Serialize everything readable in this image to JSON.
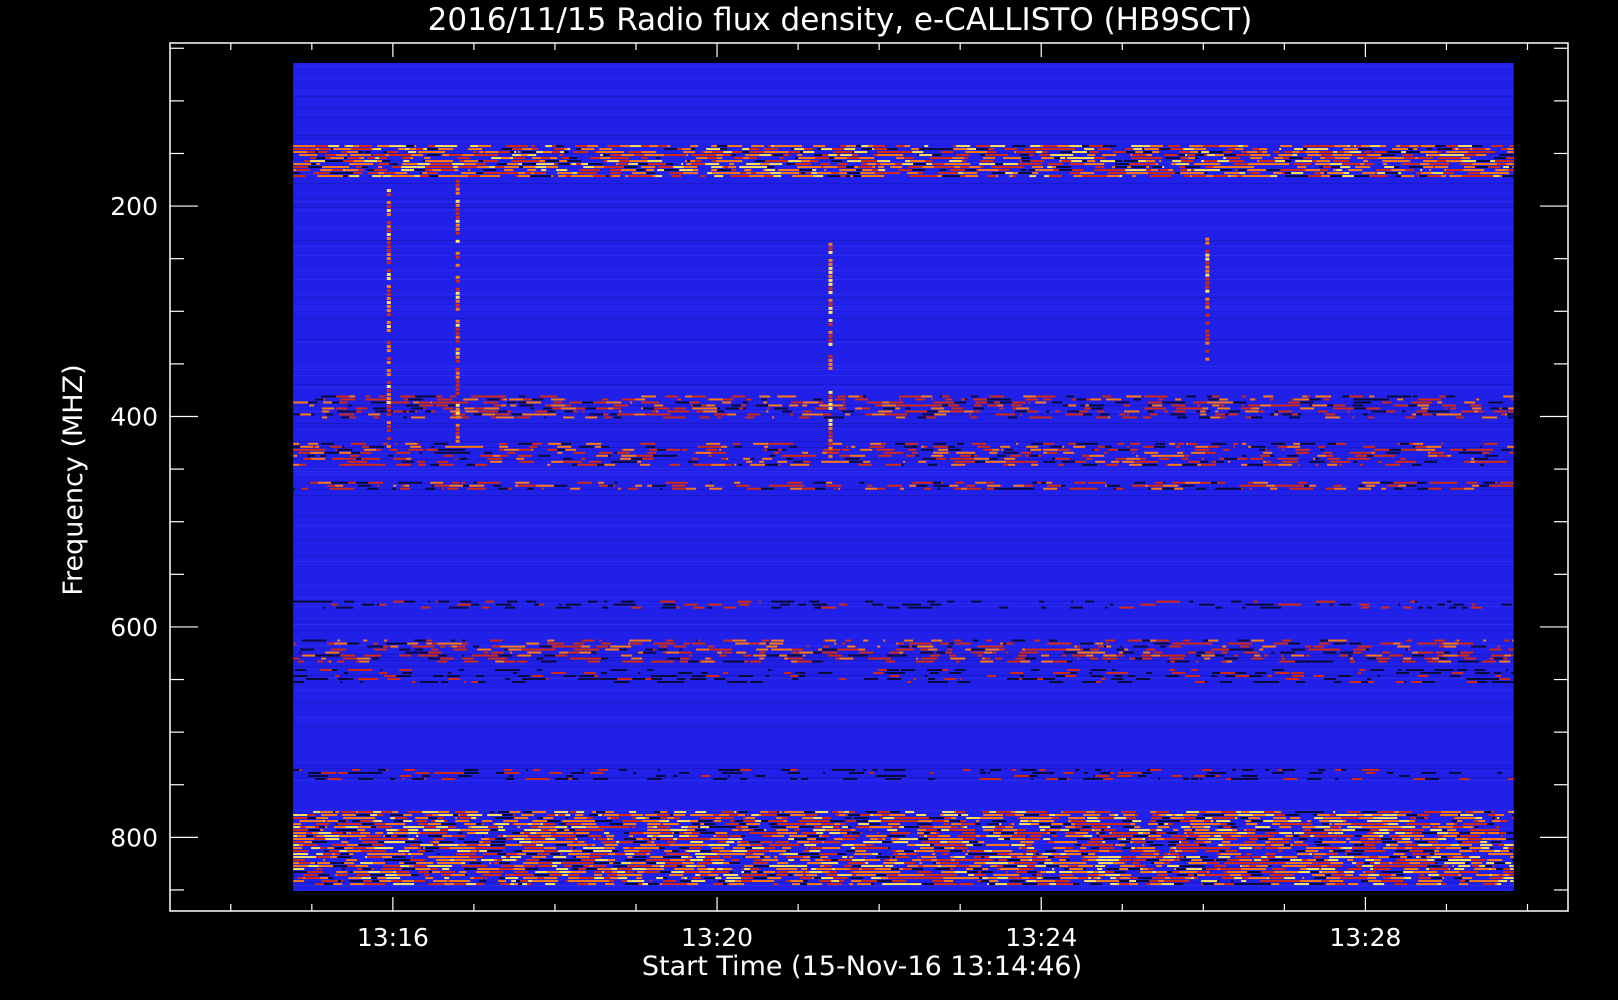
{
  "chart_data": {
    "type": "heatmap",
    "title": "2016/11/15  Radio flux density, e-CALLISTO (HB9SCT)",
    "xlabel": "Start Time (15-Nov-16 13:14:46)",
    "ylabel": "Frequency (MHZ)",
    "x_tick_labels": [
      "13:16",
      "13:20",
      "13:24",
      "13:28"
    ],
    "y_tick_labels": [
      "200",
      "400",
      "600",
      "800"
    ],
    "y_ticks": [
      200,
      400,
      600,
      800
    ],
    "y_range": [
      45,
      870
    ],
    "x_range_minutes": [
      13.25,
      30.5
    ],
    "data_x_range_minutes": [
      14.77,
      29.83
    ],
    "colors": {
      "background": "#000000",
      "axes": "#ffffff",
      "base": "#2020e8",
      "dark": "#0a0a3a",
      "red": "#d22a10",
      "orange": "#ff7a10",
      "yellow": "#ffe15a"
    },
    "bands": [
      {
        "f0": 142,
        "f1": 172,
        "intensity": "high"
      },
      {
        "f0": 380,
        "f1": 400,
        "intensity": "medium"
      },
      {
        "f0": 425,
        "f1": 445,
        "intensity": "medium"
      },
      {
        "f0": 462,
        "f1": 470,
        "intensity": "medium"
      },
      {
        "f0": 575,
        "f1": 582,
        "intensity": "low"
      },
      {
        "f0": 612,
        "f1": 632,
        "intensity": "medium"
      },
      {
        "f0": 640,
        "f1": 652,
        "intensity": "low"
      },
      {
        "f0": 735,
        "f1": 745,
        "intensity": "low"
      },
      {
        "f0": 775,
        "f1": 845,
        "intensity": "high"
      }
    ],
    "bursts": [
      {
        "t": 15.95,
        "f0": 180,
        "f1": 430
      },
      {
        "t": 16.8,
        "f0": 175,
        "f1": 425
      },
      {
        "t": 21.4,
        "f0": 235,
        "f1": 440
      },
      {
        "t": 26.05,
        "f0": 230,
        "f1": 350
      }
    ]
  }
}
